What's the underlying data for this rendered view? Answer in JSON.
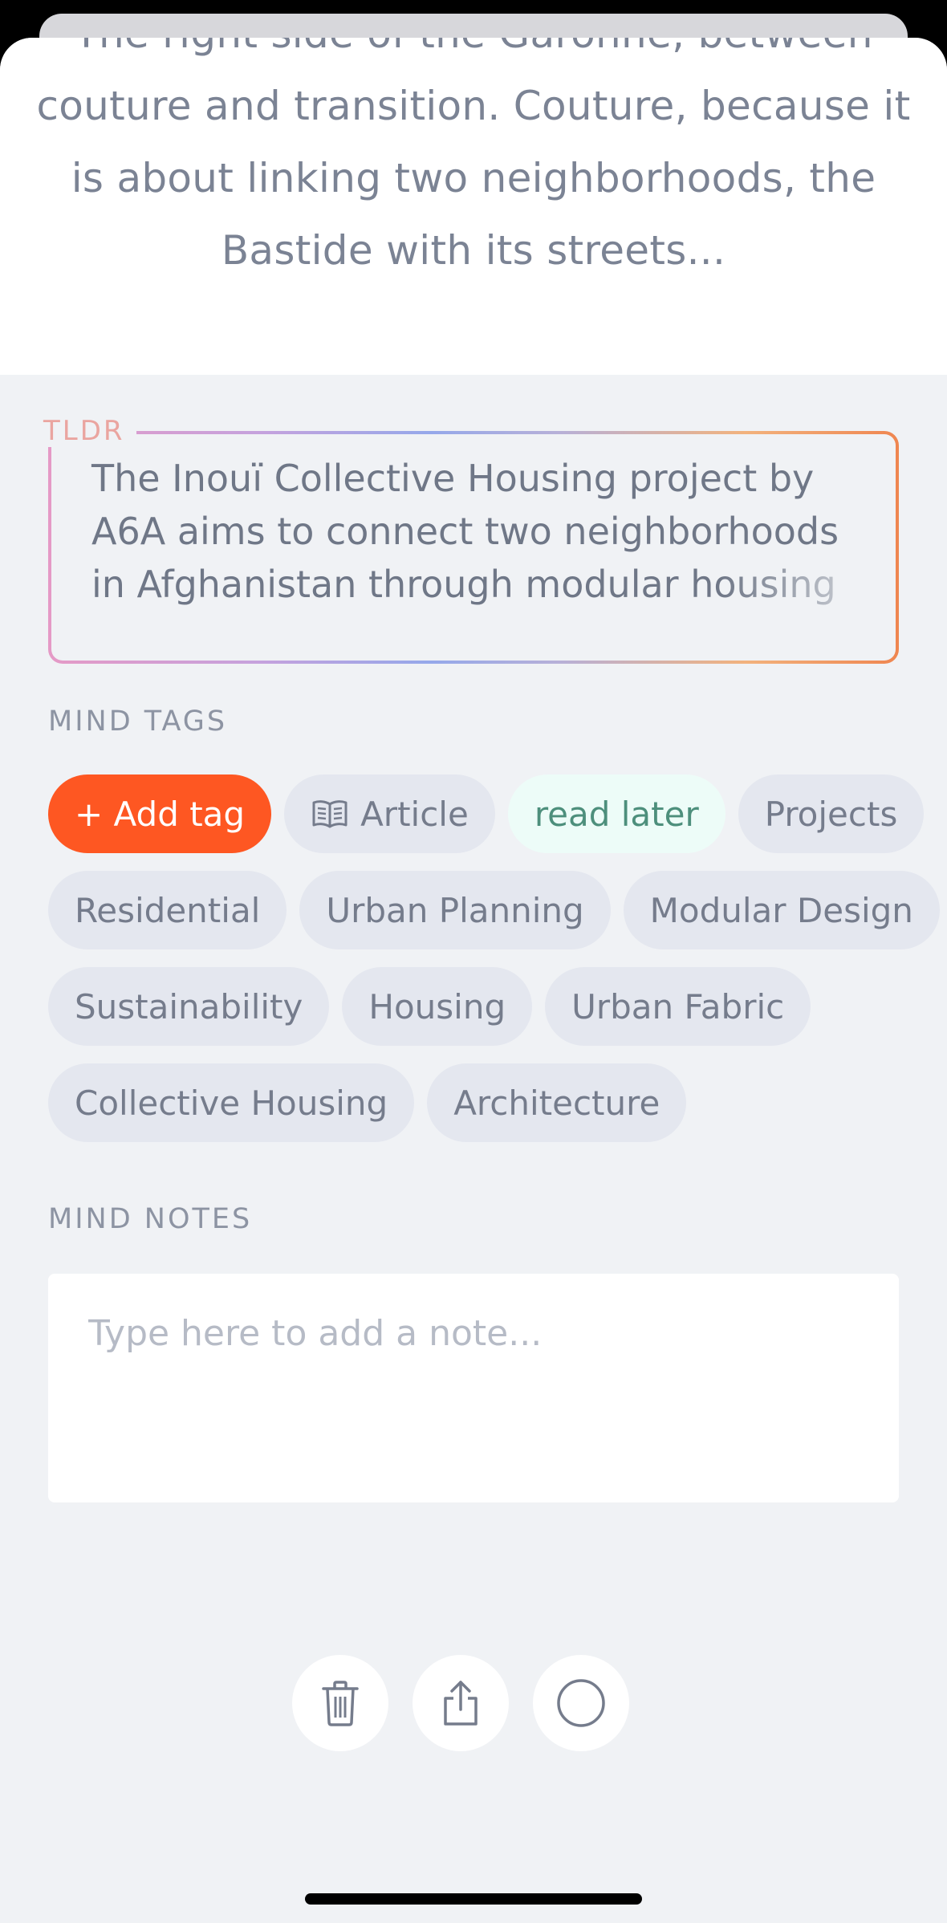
{
  "excerpt": {
    "text": "The right side of the Garonne, between couture and transition. Couture, because it is about linking two neighborhoods, the Bastide with its streets..."
  },
  "tldr": {
    "label": "TLDR",
    "text": "The Inouï Collective Housing project by\nA6A aims to connect two neighborhoods\nin Afghanistan through modular housing"
  },
  "mind_tags": {
    "label": "MIND TAGS",
    "add_label": "+ Add tag",
    "article_icon": "book-icon",
    "rows": [
      [
        "Article",
        "read later",
        "Projects"
      ],
      [
        "Residential",
        "Urban Planning",
        "Modular Design"
      ],
      [
        "Sustainability",
        "Housing",
        "Urban Fabric"
      ],
      [
        "Collective Housing",
        "Architecture"
      ]
    ]
  },
  "mind_notes": {
    "label": "MIND NOTES",
    "placeholder": "Type here to add a note..."
  },
  "actions": {
    "delete_icon": "trash-icon",
    "share_icon": "share-icon",
    "complete_icon": "circle-icon"
  },
  "colors": {
    "accent": "#fe5722",
    "read_later_bg": "#edfcf8",
    "read_later_text": "#4d8f7c",
    "tag_bg": "#e4e7ef"
  }
}
